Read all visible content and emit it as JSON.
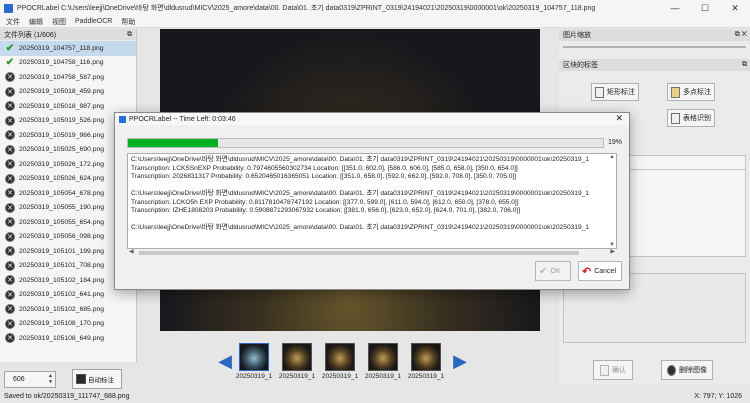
{
  "window": {
    "title": "PPOCRLabel  C:\\Users\\leejj\\OneDrive\\바탕 화면\\dldusrud\\MICV\\2025_amore\\data\\00. Data\\01. 초기 data0319\\ZPRINT_0319\\24194021\\20250319\\0000001\\ok\\20250319_104757_118.png",
    "minimize": "—",
    "maximize": "☐",
    "close": "✕"
  },
  "menu": [
    "文件",
    "编辑",
    "视图",
    "PaddleOCR",
    "帮助"
  ],
  "filelist": {
    "header": "文件列表 (1/606)",
    "float_icon": "⧉",
    "items": [
      {
        "name": "20250319_104757_118.png",
        "status": "ok",
        "selected": true
      },
      {
        "name": "20250319_104758_116.png",
        "status": "ok",
        "selected": false
      },
      {
        "name": "20250319_104758_587.png",
        "status": "pending",
        "selected": false
      },
      {
        "name": "20250319_105018_459.png",
        "status": "pending",
        "selected": false
      },
      {
        "name": "20250319_105018_987.png",
        "status": "pending",
        "selected": false
      },
      {
        "name": "20250319_105019_526.png",
        "status": "pending",
        "selected": false
      },
      {
        "name": "20250319_105019_966.png",
        "status": "pending",
        "selected": false
      },
      {
        "name": "20250319_105025_690.png",
        "status": "pending",
        "selected": false
      },
      {
        "name": "20250319_105026_172.png",
        "status": "pending",
        "selected": false
      },
      {
        "name": "20250319_105026_624.png",
        "status": "pending",
        "selected": false
      },
      {
        "name": "20250319_105054_678.png",
        "status": "pending",
        "selected": false
      },
      {
        "name": "20250319_105055_190.png",
        "status": "pending",
        "selected": false
      },
      {
        "name": "20250319_105055_654.png",
        "status": "pending",
        "selected": false
      },
      {
        "name": "20250319_105056_098.png",
        "status": "pending",
        "selected": false
      },
      {
        "name": "20250319_105101_199.png",
        "status": "pending",
        "selected": false
      },
      {
        "name": "20250319_105101_708.png",
        "status": "pending",
        "selected": false
      },
      {
        "name": "20250319_105102_184.png",
        "status": "pending",
        "selected": false
      },
      {
        "name": "20250319_105102_641.png",
        "status": "pending",
        "selected": false
      },
      {
        "name": "20250319_105102_685.png",
        "status": "pending",
        "selected": false
      },
      {
        "name": "20250319_105108_170.png",
        "status": "pending",
        "selected": false
      },
      {
        "name": "20250319_105108_649.png",
        "status": "pending",
        "selected": false
      }
    ]
  },
  "thumbnails": {
    "prev_icon": "◀",
    "next_icon": "▶",
    "items": [
      "20250319_1",
      "20250319_1",
      "20250319_1",
      "20250319_1",
      "20250319_1"
    ]
  },
  "bottom": {
    "page_value": "606",
    "auto_label_button": "自动标注"
  },
  "right": {
    "zoom_header": "图片缩放",
    "label_header": "区块的标签",
    "rect_label": "矩形标注",
    "multi_point_label": "多点标注",
    "table_recognition": "表格识别",
    "confirm_button": "确认",
    "delete_image_button": "删除图像"
  },
  "status": {
    "saved": "Saved to  ok/20250319_111747_688.png",
    "coords": "X: 797; Y: 1026"
  },
  "dialog": {
    "title": "PPOCRLabel  --  Time Left: 0:03:46",
    "close": "✕",
    "progress_percent": 19,
    "progress_label": "19%",
    "log": [
      "C:\\Users\\leejj\\OneDrive\\바탕 화면\\dldusrud\\MICV\\2025_amore\\data\\00. Data\\01. 초기 data0319\\ZPRINT_0319\\24194021\\20250319\\0000001\\ok\\20250319_1",
      "Transcription: LCKSSnEXP Probability: 0.7974605560302734 Location: [[351.0, 602.0], [586.0, 606.0], [585.0, 658.0], [350.0, 654.0]]",
      "Transcription: 2026831317 Probability: 0.6520465016365051 Location: [[351.0, 658.0], [592.0, 662.0], [592.0, 708.0], [350.0, 705.0]]",
      "",
      "C:\\Users\\leejj\\OneDrive\\바탕 화면\\dldusrud\\MICV\\2025_amore\\data\\00. Data\\01. 초기 data0319\\ZPRINT_0319\\24194021\\20250319\\0000001\\ok\\20250319_1",
      "Transcription: LCKO5h EXP Probability: 0.8117810478747192 Location: [[377.0, 599.0], [611.0, 594.0], [612.0, 650.0], [378.0, 655.0]]",
      "Transcription: IZHE1808203 Probability: 0.5908871293067932 Location: [[381.0, 656.0], [623.0, 652.0], [624.0, 701.0], [382.0, 706.0]]",
      "",
      "C:\\Users\\leejj\\OneDrive\\바탕 화면\\dldusrud\\MICV\\2025_amore\\data\\00. Data\\01. 초기 data0319\\ZPRINT_0319\\24194021\\20250319\\0000001\\ok\\20250319_1"
    ],
    "ok_button": "OK",
    "cancel_button": "Cancel"
  }
}
